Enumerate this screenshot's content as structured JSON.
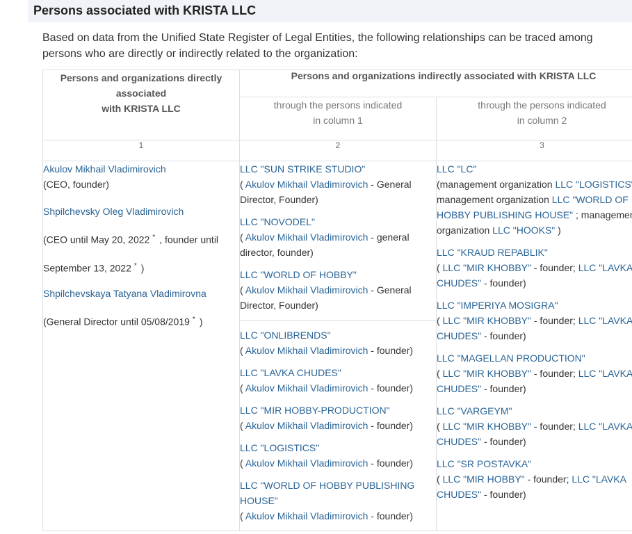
{
  "title": "Persons associated with KRISTA LLC",
  "intro": "Based on data from the Unified State Register of Legal Entities, the following relationships can be traced among persons who are directly or indirectly related to the organization:",
  "table": {
    "header_direct_1": "Persons and organizations directly associated",
    "header_direct_2": "with KRISTA LLC",
    "header_indirect": "Persons and organizations indirectly associated with KRISTA LLC",
    "sub_col2_1": "through the persons indicated",
    "sub_col2_2": "in column 1",
    "sub_col3_1": "through the persons indicated",
    "sub_col3_2": "in column 2",
    "num1": "1",
    "num2": "2",
    "num3": "3",
    "star": "*",
    "paren_open": "(",
    "paren_close": ")",
    "col1": {
      "p1_name": "Akulov Mikhail Vladimirovich",
      "p1_role": "(CEO, founder)",
      "p2_name": "Shpilchevsky Oleg Vladimirovich",
      "p2_role_a": "(CEO until May 20, 2022",
      "p2_role_b": ", founder until",
      "p2_role_c": "September 13, 2022",
      "p3_name": "Shpilchevskaya Tatyana Vladimirovna",
      "p3_role": "(General Director until 05/08/2019"
    },
    "col2": {
      "person": "Akulov Mikhail Vladimirovich",
      "gdf_cap": " - General Director, Founder)",
      "gdf_low": " - general director, founder)",
      "founder": " - founder)",
      "o1": "LLC \"SUN STRIKE STUDIO\"",
      "o2": "LLC \"NOVODEL\"",
      "o3": "LLC \"WORLD OF HOBBY\"",
      "o4": "LLC \"ONLIBRENDS\"",
      "o5": "LLC \"LAVKA CHUDES\"",
      "o6": "LLC \"MIR HOBBY-PRODUCTION\"",
      "o7": "LLC \"LOGISTICS\"",
      "o8": "LLC \"WORLD OF HOBBY PUBLISHING HOUSE\""
    },
    "col3": {
      "lc_name": "LLC \"LC\"",
      "lc_t1": "(management organization ",
      "lc_l1": "LLC \"LOGISTICS\"",
      "lc_t2": " ; management organization ",
      "lc_l2": "LLC \"WORLD OF HOBBY PUBLISHING HOUSE\"",
      "lc_t3": " ; management organization ",
      "lc_l3": "LLC \"HOOKS\"",
      "lc_t4": " )",
      "founder_sep": " - founder; ",
      "founder_end": " - founder)",
      "mir_khobby": "LLC \"MIR KHOBBY\"",
      "mir_hobby": "LLC \"MIR HOBBY\"",
      "lavka": "LLC \"LAVKA CHUDES\"",
      "o1": "LLC \"KRAUD REPABLIK\"",
      "o2": "LLC \"IMPERIYA MOSIGRA\"",
      "o3": "LLC \"MAGELLAN PRODUCTION\"",
      "o4": "LLC \"VARGEYM\"",
      "o5": "LLC \"SR POSTAVKA\""
    }
  }
}
